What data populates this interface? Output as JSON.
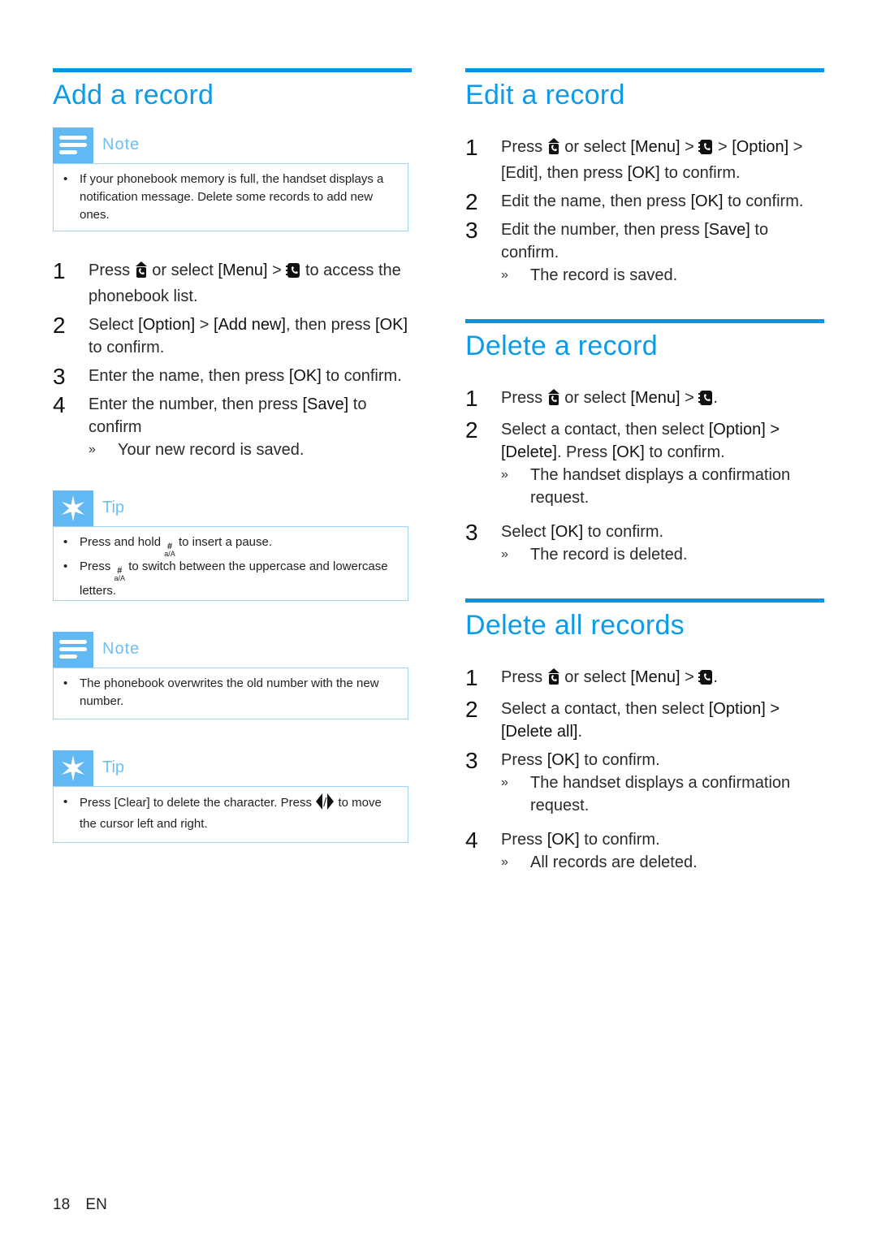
{
  "left": {
    "title": "Add a record",
    "note1": {
      "label": "Note",
      "icon": "note-lines-icon",
      "items": [
        "If your phonebook memory is full, the handset displays a notification message. Delete some records to add new ones."
      ]
    },
    "steps": [
      {
        "num": "1",
        "parts": [
          "Press",
          "or select",
          "[Menu]",
          ">",
          "to access the phonebook list."
        ]
      },
      {
        "num": "2",
        "text_a": "Select",
        "kw1": "[Option]",
        "sep": ">",
        "kw2": "[Add new]",
        "text_b": ", then press",
        "kw3": "[OK]",
        "text_c": "to confirm."
      },
      {
        "num": "3",
        "text_a": "Enter the name, then press",
        "kw1": "[OK]",
        "text_b": "to confirm."
      },
      {
        "num": "4",
        "text_a": "Enter the number, then press",
        "kw1": "[Save]",
        "text_b": "to confirm",
        "result": "Your new record is saved."
      }
    ],
    "tip1": {
      "label": "Tip",
      "icon": "tip-asterisk-icon",
      "item1_a": "Press and hold",
      "item1_b": "to insert a pause.",
      "item2_a": "Press",
      "item2_b": "to switch between the uppercase and lowercase letters.",
      "key_top": "#",
      "key_bottom": "a/A"
    },
    "note2": {
      "label": "Note",
      "items": [
        "The phonebook overwrites the old number with the new number."
      ]
    },
    "tip2": {
      "label": "Tip",
      "item_a": "Press [Clear] to delete the character. Press",
      "item_sep": "/",
      "item_b": "to move the cursor left and right."
    }
  },
  "right": {
    "edit": {
      "title": "Edit a record",
      "step1": {
        "num": "1",
        "a": "Press",
        "b": "or select",
        "menu": "[Menu]",
        "gt": ">",
        "gt2": ">",
        "opt": "[Option]",
        "c": "> [Edit], then press",
        "ok": "[OK]",
        "d": "to confirm."
      },
      "step2": {
        "num": "2",
        "a": "Edit the name, then press",
        "ok": "[OK]",
        "b": "to confirm."
      },
      "step3": {
        "num": "3",
        "a": "Edit the number, then press",
        "save": "[Save]",
        "b": "to confirm.",
        "result": "The record is saved."
      }
    },
    "delete": {
      "title": "Delete a record",
      "step1": {
        "num": "1",
        "a": "Press",
        "b": "or select",
        "menu": "[Menu]",
        "gt": ">",
        "end": "."
      },
      "step2": {
        "num": "2",
        "a": "Select a contact, then select",
        "opt": "[Option] >",
        "del": "[Delete]",
        "b": ". Press",
        "ok": "[OK]",
        "c": "to confirm.",
        "result": "The handset displays a confirmation request."
      },
      "step3": {
        "num": "3",
        "a": "Select",
        "ok": "[OK]",
        "b": "to confirm.",
        "result": "The record is deleted."
      }
    },
    "delete_all": {
      "title": "Delete all records",
      "step1": {
        "num": "1",
        "a": "Press",
        "b": "or select",
        "menu": "[Menu]",
        "gt": ">",
        "end": "."
      },
      "step2": {
        "num": "2",
        "a": "Select a contact, then select",
        "opt": "[Option] >",
        "del": "[Delete all]",
        "b": "."
      },
      "step3": {
        "num": "3",
        "a": "Press",
        "ok": "[OK]",
        "b": "to confirm.",
        "result": "The handset displays a confirmation request."
      },
      "step4": {
        "num": "4",
        "a": "Press",
        "ok": "[OK]",
        "b": "to confirm.",
        "result": "All records are deleted."
      }
    }
  },
  "footer": {
    "page": "18",
    "lang": "EN"
  },
  "result_marker": "»",
  "colors": {
    "accent": "#0b9be9",
    "rule": "#0095e8",
    "box_icon": "#62b8f3",
    "box_border": "#9fd3f7"
  }
}
